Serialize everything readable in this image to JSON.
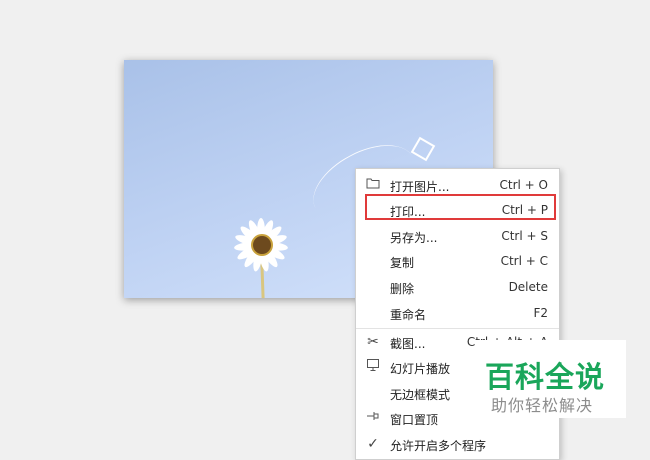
{
  "menu": {
    "items": [
      {
        "label": "打开图片...",
        "shortcut": "Ctrl + O",
        "icon": "folder-icon"
      },
      {
        "label": "打印...",
        "shortcut": "Ctrl + P",
        "icon": ""
      },
      {
        "label": "另存为...",
        "shortcut": "Ctrl + S",
        "icon": ""
      },
      {
        "label": "复制",
        "shortcut": "Ctrl + C",
        "icon": ""
      },
      {
        "label": "删除",
        "shortcut": "Delete",
        "icon": ""
      },
      {
        "label": "重命名",
        "shortcut": "F2",
        "icon": ""
      },
      {
        "label": "截图...",
        "shortcut": "Ctrl + Alt + A",
        "icon": "scissors-icon"
      },
      {
        "label": "幻灯片播放",
        "shortcut": "",
        "icon": "slideshow-icon"
      },
      {
        "label": "无边框模式",
        "shortcut": "",
        "icon": ""
      },
      {
        "label": "窗口置顶",
        "shortcut": "",
        "icon": "pin-icon"
      },
      {
        "label": "允许开启多个程序",
        "shortcut": "",
        "icon": "check-icon"
      }
    ],
    "highlighted_item": "打印..."
  },
  "watermark": {
    "title": "百科全说",
    "subtitle": "助你轻松解决"
  },
  "colors": {
    "highlight": "#e03a3a",
    "watermark_title": "#1aa65a"
  }
}
